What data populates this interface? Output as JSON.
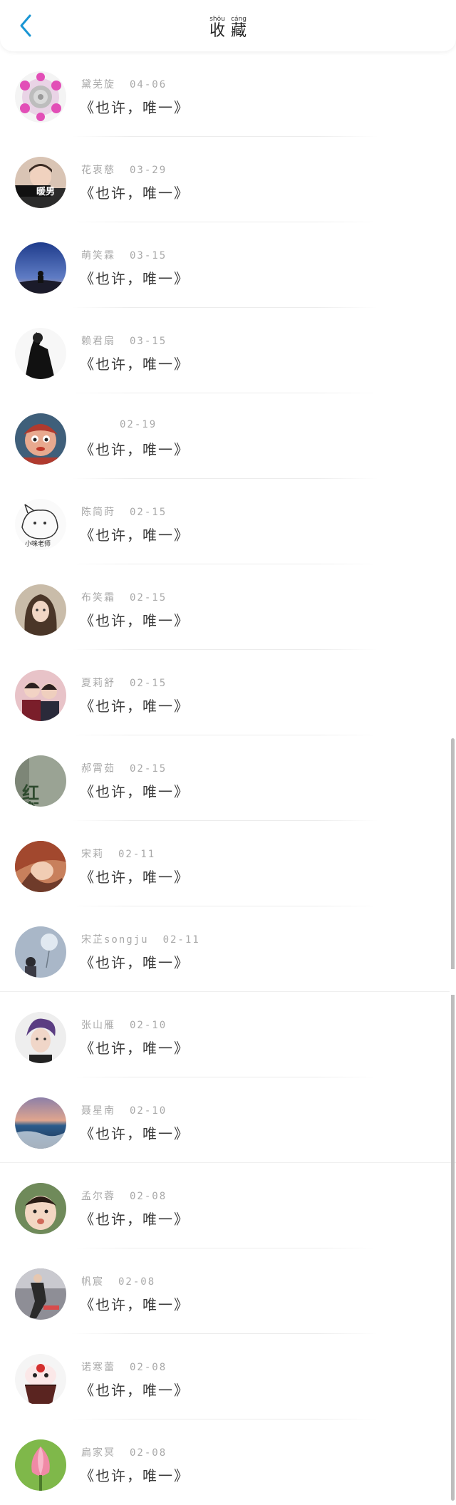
{
  "header": {
    "title_chars": [
      {
        "pinyin": "shōu",
        "hanzi": "收"
      },
      {
        "pinyin": "cáng",
        "hanzi": "藏"
      }
    ],
    "accent": "#1a96d4"
  },
  "items": [
    {
      "name": "黛芜旋",
      "date": "04-06",
      "quote": "《也许，唯一》",
      "avatar": "flower-bouquet"
    },
    {
      "name": "花衷慈",
      "date": "03-29",
      "quote": "《也许，唯一》",
      "avatar": "warm-boy",
      "avatar_text": "暖男"
    },
    {
      "name": "萌笑霖",
      "date": "03-15",
      "quote": "《也许，唯一》",
      "avatar": "night-sky"
    },
    {
      "name": "赖君扇",
      "date": "03-15",
      "quote": "《也许，唯一》",
      "avatar": "black-white-figure"
    },
    {
      "name": "",
      "date": "02-19",
      "quote": "《也许，唯一》",
      "avatar": "cartoon-doll"
    },
    {
      "name": "陈简莳",
      "date": "02-15",
      "quote": "《也许，唯一》",
      "avatar": "sketch-cat",
      "avatar_text": "小咪老师"
    },
    {
      "name": "布笑霜",
      "date": "02-15",
      "quote": "《也许，唯一》",
      "avatar": "girl-portrait"
    },
    {
      "name": "夏莉舒",
      "date": "02-15",
      "quote": "《也许，唯一》",
      "avatar": "two-men"
    },
    {
      "name": "郝霄茹",
      "date": "02-15",
      "quote": "《也许，唯一》",
      "avatar": "red-guard-text",
      "avatar_text": "红衛"
    },
    {
      "name": "宋莉",
      "date": "02-11",
      "quote": "《也许，唯一》",
      "avatar": "woman-red-hair"
    },
    {
      "name": "宋芷songju",
      "date": "02-11",
      "quote": "《也许，唯一》",
      "avatar": "dandelion-boy"
    },
    {
      "name": "张山雁",
      "date": "02-10",
      "quote": "《也许，唯一》",
      "avatar": "purple-hair-boy"
    },
    {
      "name": "聂星南",
      "date": "02-10",
      "quote": "《也许，唯一》",
      "avatar": "lake-landscape"
    },
    {
      "name": "孟尔蓉",
      "date": "02-08",
      "quote": "《也许，唯一》",
      "avatar": "baby-face"
    },
    {
      "name": "帆宸",
      "date": "02-08",
      "quote": "《也许，唯一》",
      "avatar": "runner-photo"
    },
    {
      "name": "诺寒蕾",
      "date": "02-08",
      "quote": "《也许，唯一》",
      "avatar": "cupcake"
    },
    {
      "name": "扁家冥",
      "date": "02-08",
      "quote": "《也许，唯一》",
      "avatar": "lotus-flower"
    }
  ]
}
